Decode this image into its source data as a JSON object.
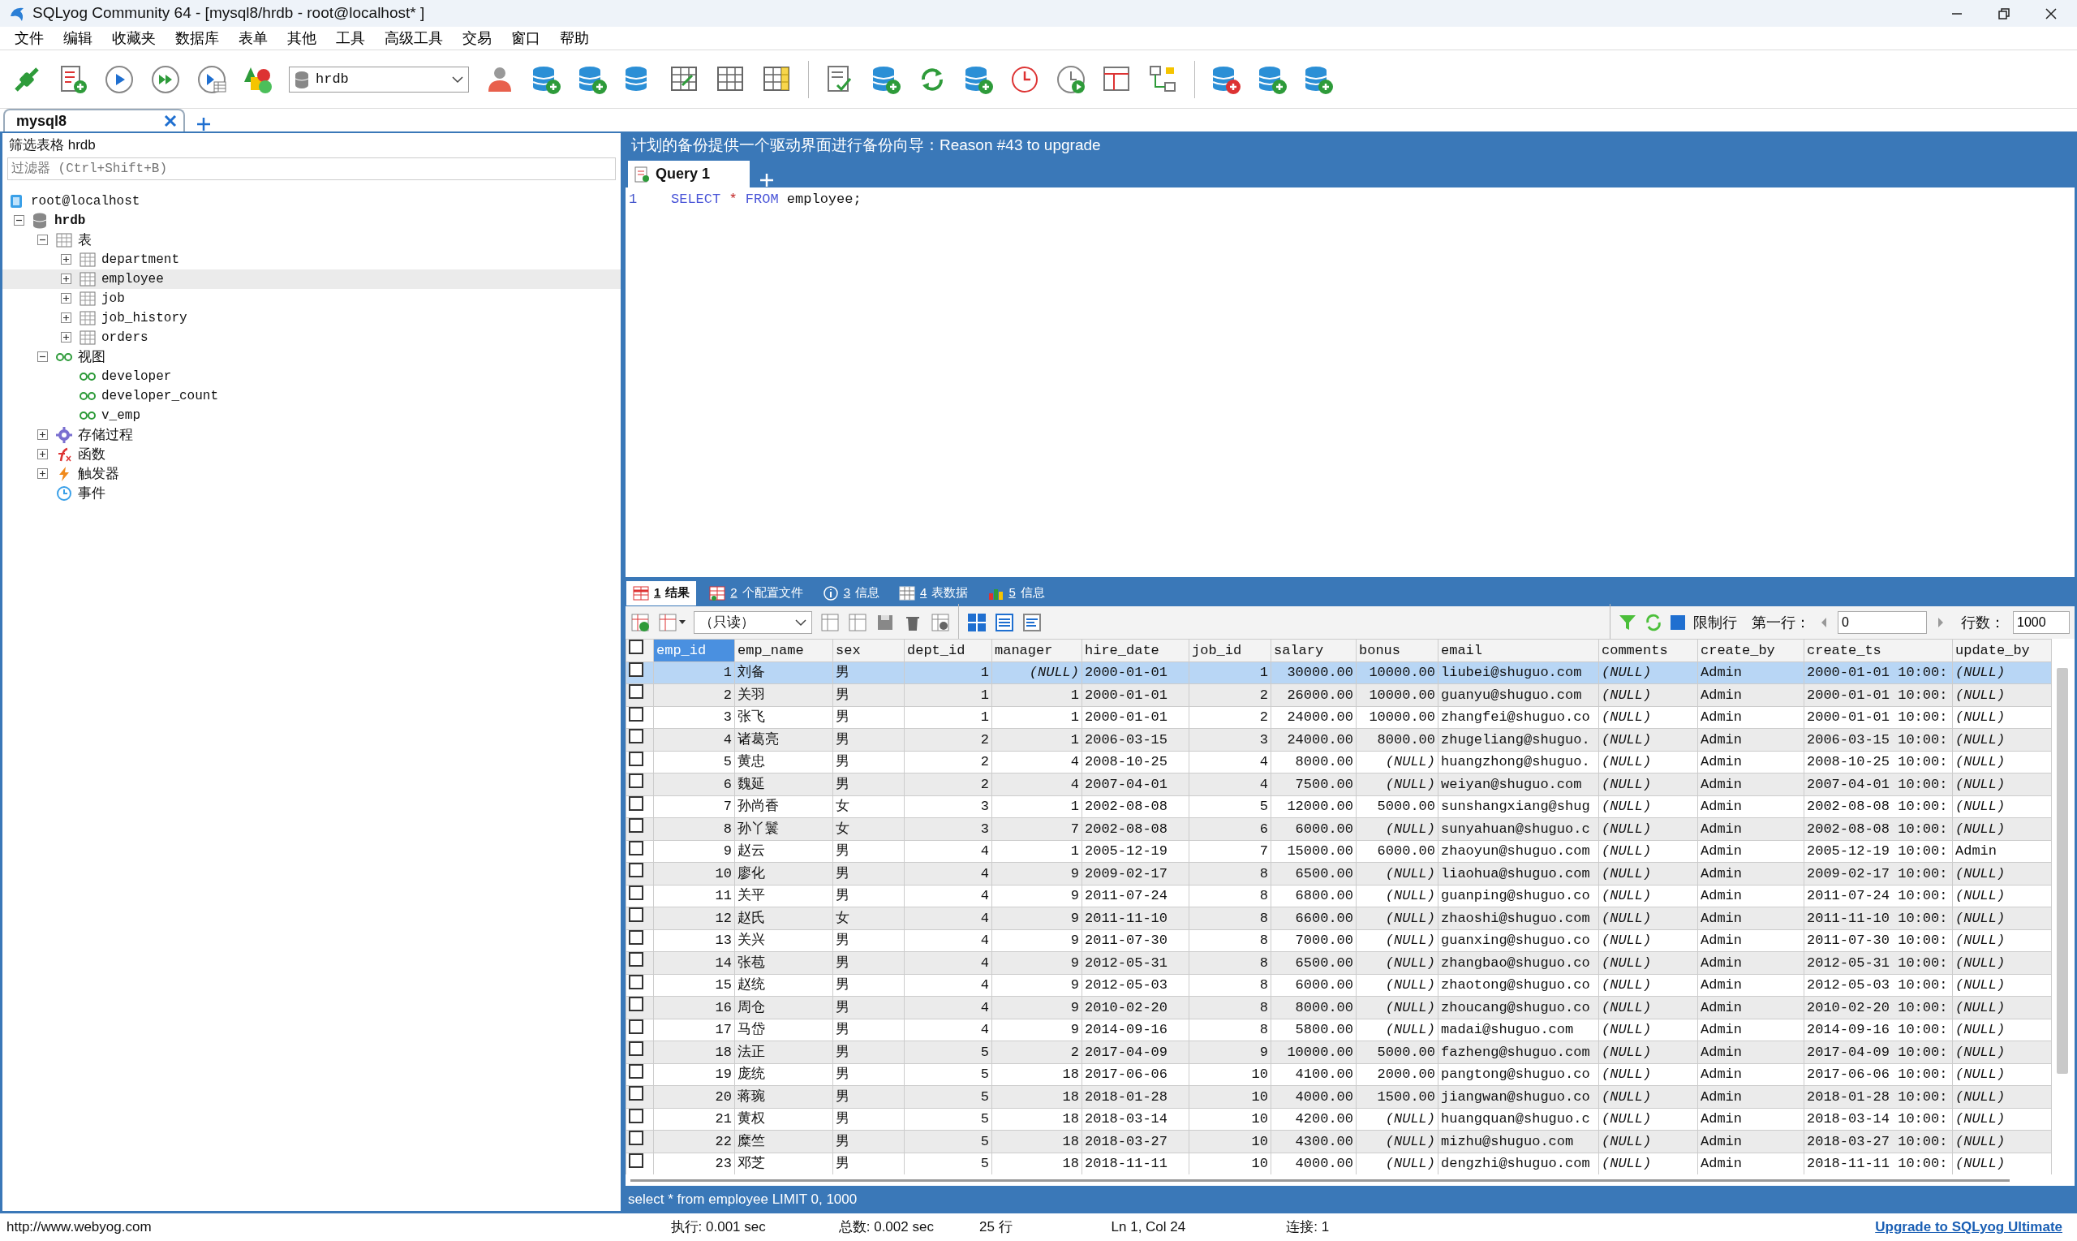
{
  "window": {
    "title": "SQLyog Community 64 - [mysql8/hrdb - root@localhost* ]"
  },
  "menu": [
    "文件",
    "编辑",
    "收藏夹",
    "数据库",
    "表单",
    "其他",
    "工具",
    "高级工具",
    "交易",
    "窗口",
    "帮助"
  ],
  "toolbar": {
    "database_selector": "hrdb"
  },
  "connection_tabs": [
    {
      "label": "mysql8",
      "selected": true
    }
  ],
  "sidebar": {
    "header": "筛选表格 hrdb",
    "filter": {
      "placeholder": "过滤器 (Ctrl+Shift+B)"
    },
    "tree": [
      {
        "label": "root@localhost",
        "kind": "server",
        "selected": false,
        "children": [
          {
            "label": "hrdb",
            "kind": "database",
            "expanded": true,
            "selected": false,
            "children": [
              {
                "label": "表",
                "kind": "tables",
                "expanded": true,
                "selected": false,
                "children": [
                  {
                    "label": "department",
                    "kind": "table",
                    "expanded": false,
                    "selected": false
                  },
                  {
                    "label": "employee",
                    "kind": "table",
                    "expanded": false,
                    "selected": true
                  },
                  {
                    "label": "job",
                    "kind": "table",
                    "expanded": false,
                    "selected": false
                  },
                  {
                    "label": "job_history",
                    "kind": "table",
                    "expanded": false,
                    "selected": false
                  },
                  {
                    "label": "orders",
                    "kind": "table",
                    "expanded": false,
                    "selected": false
                  }
                ]
              },
              {
                "label": "视图",
                "kind": "views",
                "expanded": true,
                "selected": false,
                "children": [
                  {
                    "label": "developer",
                    "kind": "view",
                    "selected": false
                  },
                  {
                    "label": "developer_count",
                    "kind": "view",
                    "selected": false
                  },
                  {
                    "label": "v_emp",
                    "kind": "view",
                    "selected": false
                  }
                ]
              },
              {
                "label": "存储过程",
                "kind": "procedures",
                "expanded": false,
                "selected": false
              },
              {
                "label": "函数",
                "kind": "functions",
                "expanded": false,
                "selected": false
              },
              {
                "label": "触发器",
                "kind": "triggers",
                "expanded": false,
                "selected": false
              },
              {
                "label": "事件",
                "kind": "events",
                "selected": false
              }
            ]
          }
        ]
      }
    ]
  },
  "notice": "计划的备份提供一个驱动界面进行备份向导：Reason #43 to upgrade",
  "query_tabs": [
    {
      "label": "Query 1",
      "selected": true
    }
  ],
  "editor": {
    "lines": [
      {
        "number": "1",
        "tokens": [
          {
            "text": "SELECT",
            "kind": "keyword"
          },
          {
            "text": "*",
            "kind": "operator"
          },
          {
            "text": "FROM",
            "kind": "keyword"
          },
          {
            "text": "employee;",
            "kind": "plain"
          }
        ]
      }
    ]
  },
  "result_tabs": [
    {
      "number": "1",
      "label": "结果",
      "selected": true
    },
    {
      "number": "2",
      "label": "个配置文件",
      "selected": false
    },
    {
      "number": "3",
      "label": "信息",
      "selected": false
    },
    {
      "number": "4",
      "label": "表数据",
      "selected": false
    },
    {
      "number": "5",
      "label": "信息",
      "selected": false
    }
  ],
  "result_toolbar": {
    "mode": "（只读）",
    "limit_rows": {
      "label": "限制行",
      "checked": true
    },
    "first_row": {
      "label": "第一行：",
      "value": "0"
    },
    "row_count": {
      "label": "行数：",
      "value": "1000"
    }
  },
  "table": {
    "all_checked": false,
    "columns": [
      {
        "label": "emp_id",
        "kind": "number",
        "selected": true
      },
      {
        "label": "emp_name",
        "kind": "text",
        "selected": false
      },
      {
        "label": "sex",
        "kind": "text",
        "selected": false
      },
      {
        "label": "dept_id",
        "kind": "number",
        "selected": false
      },
      {
        "label": "manager",
        "kind": "number",
        "selected": false
      },
      {
        "label": "hire_date",
        "kind": "text",
        "selected": false
      },
      {
        "label": "job_id",
        "kind": "number",
        "selected": false
      },
      {
        "label": "salary",
        "kind": "number",
        "selected": false
      },
      {
        "label": "bonus",
        "kind": "number",
        "selected": false
      },
      {
        "label": "email",
        "kind": "text",
        "selected": false
      },
      {
        "label": "comments",
        "kind": "text",
        "selected": false
      },
      {
        "label": "create_by",
        "kind": "text",
        "selected": false
      },
      {
        "label": "create_ts",
        "kind": "text",
        "selected": false
      },
      {
        "label": "update_by",
        "kind": "text",
        "selected": false
      }
    ],
    "rows": [
      {
        "checked": false,
        "selected": true,
        "cells": [
          "1",
          "刘备",
          "男",
          "1",
          {
            "text": "(NULL)",
            "null": true
          },
          "2000-01-01",
          "1",
          "30000.00",
          "10000.00",
          "liubei@shuguo.com",
          {
            "text": "(NULL)",
            "null": true
          },
          "Admin",
          "2000-01-01 10:00:",
          {
            "text": "(NULL)",
            "null": true
          }
        ]
      },
      {
        "checked": false,
        "selected": false,
        "cells": [
          "2",
          "关羽",
          "男",
          "1",
          "1",
          "2000-01-01",
          "2",
          "26000.00",
          "10000.00",
          "guanyu@shuguo.com",
          {
            "text": "(NULL)",
            "null": true
          },
          "Admin",
          "2000-01-01 10:00:",
          {
            "text": "(NULL)",
            "null": true
          }
        ]
      },
      {
        "checked": false,
        "selected": false,
        "cells": [
          "3",
          "张飞",
          "男",
          "1",
          "1",
          "2000-01-01",
          "2",
          "24000.00",
          "10000.00",
          "zhangfei@shuguo.co",
          {
            "text": "(NULL)",
            "null": true
          },
          "Admin",
          "2000-01-01 10:00:",
          {
            "text": "(NULL)",
            "null": true
          }
        ]
      },
      {
        "checked": false,
        "selected": false,
        "cells": [
          "4",
          "诸葛亮",
          "男",
          "2",
          "1",
          "2006-03-15",
          "3",
          "24000.00",
          "8000.00",
          "zhugeliang@shuguo.",
          {
            "text": "(NULL)",
            "null": true
          },
          "Admin",
          "2006-03-15 10:00:",
          {
            "text": "(NULL)",
            "null": true
          }
        ]
      },
      {
        "checked": false,
        "selected": false,
        "cells": [
          "5",
          "黄忠",
          "男",
          "2",
          "4",
          "2008-10-25",
          "4",
          "8000.00",
          {
            "text": "(NULL)",
            "null": true
          },
          "huangzhong@shuguo.",
          {
            "text": "(NULL)",
            "null": true
          },
          "Admin",
          "2008-10-25 10:00:",
          {
            "text": "(NULL)",
            "null": true
          }
        ]
      },
      {
        "checked": false,
        "selected": false,
        "cells": [
          "6",
          "魏延",
          "男",
          "2",
          "4",
          "2007-04-01",
          "4",
          "7500.00",
          {
            "text": "(NULL)",
            "null": true
          },
          "weiyan@shuguo.com",
          {
            "text": "(NULL)",
            "null": true
          },
          "Admin",
          "2007-04-01 10:00:",
          {
            "text": "(NULL)",
            "null": true
          }
        ]
      },
      {
        "checked": false,
        "selected": false,
        "cells": [
          "7",
          "孙尚香",
          "女",
          "3",
          "1",
          "2002-08-08",
          "5",
          "12000.00",
          "5000.00",
          "sunshangxiang@shug",
          {
            "text": "(NULL)",
            "null": true
          },
          "Admin",
          "2002-08-08 10:00:",
          {
            "text": "(NULL)",
            "null": true
          }
        ]
      },
      {
        "checked": false,
        "selected": false,
        "cells": [
          "8",
          "孙丫鬟",
          "女",
          "3",
          "7",
          "2002-08-08",
          "6",
          "6000.00",
          {
            "text": "(NULL)",
            "null": true
          },
          "sunyahuan@shuguo.c",
          {
            "text": "(NULL)",
            "null": true
          },
          "Admin",
          "2002-08-08 10:00:",
          {
            "text": "(NULL)",
            "null": true
          }
        ]
      },
      {
        "checked": false,
        "selected": false,
        "cells": [
          "9",
          "赵云",
          "男",
          "4",
          "1",
          "2005-12-19",
          "7",
          "15000.00",
          "6000.00",
          "zhaoyun@shuguo.com",
          {
            "text": "(NULL)",
            "null": true
          },
          "Admin",
          "2005-12-19 10:00:",
          "Admin"
        ]
      },
      {
        "checked": false,
        "selected": false,
        "cells": [
          "10",
          "廖化",
          "男",
          "4",
          "9",
          "2009-02-17",
          "8",
          "6500.00",
          {
            "text": "(NULL)",
            "null": true
          },
          "liaohua@shuguo.com",
          {
            "text": "(NULL)",
            "null": true
          },
          "Admin",
          "2009-02-17 10:00:",
          {
            "text": "(NULL)",
            "null": true
          }
        ]
      },
      {
        "checked": false,
        "selected": false,
        "cells": [
          "11",
          "关平",
          "男",
          "4",
          "9",
          "2011-07-24",
          "8",
          "6800.00",
          {
            "text": "(NULL)",
            "null": true
          },
          "guanping@shuguo.co",
          {
            "text": "(NULL)",
            "null": true
          },
          "Admin",
          "2011-07-24 10:00:",
          {
            "text": "(NULL)",
            "null": true
          }
        ]
      },
      {
        "checked": false,
        "selected": false,
        "cells": [
          "12",
          "赵氏",
          "女",
          "4",
          "9",
          "2011-11-10",
          "8",
          "6600.00",
          {
            "text": "(NULL)",
            "null": true
          },
          "zhaoshi@shuguo.com",
          {
            "text": "(NULL)",
            "null": true
          },
          "Admin",
          "2011-11-10 10:00:",
          {
            "text": "(NULL)",
            "null": true
          }
        ]
      },
      {
        "checked": false,
        "selected": false,
        "cells": [
          "13",
          "关兴",
          "男",
          "4",
          "9",
          "2011-07-30",
          "8",
          "7000.00",
          {
            "text": "(NULL)",
            "null": true
          },
          "guanxing@shuguo.co",
          {
            "text": "(NULL)",
            "null": true
          },
          "Admin",
          "2011-07-30 10:00:",
          {
            "text": "(NULL)",
            "null": true
          }
        ]
      },
      {
        "checked": false,
        "selected": false,
        "cells": [
          "14",
          "张苞",
          "男",
          "4",
          "9",
          "2012-05-31",
          "8",
          "6500.00",
          {
            "text": "(NULL)",
            "null": true
          },
          "zhangbao@shuguo.co",
          {
            "text": "(NULL)",
            "null": true
          },
          "Admin",
          "2012-05-31 10:00:",
          {
            "text": "(NULL)",
            "null": true
          }
        ]
      },
      {
        "checked": false,
        "selected": false,
        "cells": [
          "15",
          "赵统",
          "男",
          "4",
          "9",
          "2012-05-03",
          "8",
          "6000.00",
          {
            "text": "(NULL)",
            "null": true
          },
          "zhaotong@shuguo.co",
          {
            "text": "(NULL)",
            "null": true
          },
          "Admin",
          "2012-05-03 10:00:",
          {
            "text": "(NULL)",
            "null": true
          }
        ]
      },
      {
        "checked": false,
        "selected": false,
        "cells": [
          "16",
          "周仓",
          "男",
          "4",
          "9",
          "2010-02-20",
          "8",
          "8000.00",
          {
            "text": "(NULL)",
            "null": true
          },
          "zhoucang@shuguo.co",
          {
            "text": "(NULL)",
            "null": true
          },
          "Admin",
          "2010-02-20 10:00:",
          {
            "text": "(NULL)",
            "null": true
          }
        ]
      },
      {
        "checked": false,
        "selected": false,
        "cells": [
          "17",
          "马岱",
          "男",
          "4",
          "9",
          "2014-09-16",
          "8",
          "5800.00",
          {
            "text": "(NULL)",
            "null": true
          },
          "madai@shuguo.com",
          {
            "text": "(NULL)",
            "null": true
          },
          "Admin",
          "2014-09-16 10:00:",
          {
            "text": "(NULL)",
            "null": true
          }
        ]
      },
      {
        "checked": false,
        "selected": false,
        "cells": [
          "18",
          "法正",
          "男",
          "5",
          "2",
          "2017-04-09",
          "9",
          "10000.00",
          "5000.00",
          "fazheng@shuguo.com",
          {
            "text": "(NULL)",
            "null": true
          },
          "Admin",
          "2017-04-09 10:00:",
          {
            "text": "(NULL)",
            "null": true
          }
        ]
      },
      {
        "checked": false,
        "selected": false,
        "cells": [
          "19",
          "庞统",
          "男",
          "5",
          "18",
          "2017-06-06",
          "10",
          "4100.00",
          "2000.00",
          "pangtong@shuguo.co",
          {
            "text": "(NULL)",
            "null": true
          },
          "Admin",
          "2017-06-06 10:00:",
          {
            "text": "(NULL)",
            "null": true
          }
        ]
      },
      {
        "checked": false,
        "selected": false,
        "cells": [
          "20",
          "蒋琬",
          "男",
          "5",
          "18",
          "2018-01-28",
          "10",
          "4000.00",
          "1500.00",
          "jiangwan@shuguo.co",
          {
            "text": "(NULL)",
            "null": true
          },
          "Admin",
          "2018-01-28 10:00:",
          {
            "text": "(NULL)",
            "null": true
          }
        ]
      },
      {
        "checked": false,
        "selected": false,
        "cells": [
          "21",
          "黄权",
          "男",
          "5",
          "18",
          "2018-03-14",
          "10",
          "4200.00",
          {
            "text": "(NULL)",
            "null": true
          },
          "huangquan@shuguo.c",
          {
            "text": "(NULL)",
            "null": true
          },
          "Admin",
          "2018-03-14 10:00:",
          {
            "text": "(NULL)",
            "null": true
          }
        ]
      },
      {
        "checked": false,
        "selected": false,
        "cells": [
          "22",
          "糜竺",
          "男",
          "5",
          "18",
          "2018-03-27",
          "10",
          "4300.00",
          {
            "text": "(NULL)",
            "null": true
          },
          "mizhu@shuguo.com",
          {
            "text": "(NULL)",
            "null": true
          },
          "Admin",
          "2018-03-27 10:00:",
          {
            "text": "(NULL)",
            "null": true
          }
        ]
      },
      {
        "checked": false,
        "selected": false,
        "cells": [
          "23",
          "邓芝",
          "男",
          "5",
          "18",
          "2018-11-11",
          "10",
          "4000.00",
          {
            "text": "(NULL)",
            "null": true
          },
          "dengzhi@shuguo.com",
          {
            "text": "(NULL)",
            "null": true
          },
          "Admin",
          "2018-11-11 10:00:",
          {
            "text": "(NULL)",
            "null": true
          }
        ]
      }
    ]
  },
  "sql_status": "select * from employee LIMIT 0, 1000",
  "status_bar": {
    "link": "http://www.webyog.com",
    "items": [
      "执行: 0.001 sec",
      "总数: 0.002 sec",
      "25 行",
      "Ln 1, Col 24",
      "连接: 1"
    ],
    "upgrade": "Upgrade to SQLyog Ultimate"
  }
}
